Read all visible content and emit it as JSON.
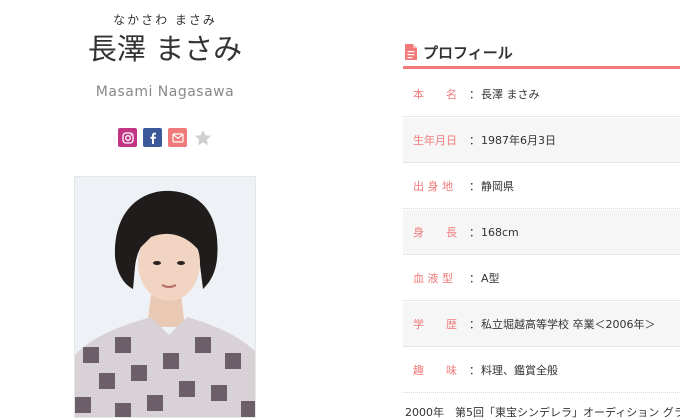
{
  "profile": {
    "furigana": "なかさわ まさみ",
    "name_jp": "長澤 まさみ",
    "name_en": "Masami Nagasawa"
  },
  "social": [
    {
      "name": "instagram-icon",
      "color": "#c13584"
    },
    {
      "name": "facebook-icon",
      "color": "#3b5998"
    },
    {
      "name": "mail-icon",
      "color": "#f07a7a"
    },
    {
      "name": "star-icon",
      "color": "#cccccc"
    }
  ],
  "section": {
    "title": "プロフィール",
    "accent": "#f07a7a"
  },
  "rows": [
    {
      "label": "本　　名",
      "value": "長澤 まさみ"
    },
    {
      "label": "生年月日",
      "value": "1987年6月3日"
    },
    {
      "label": "出 身 地",
      "value": "静岡県"
    },
    {
      "label": "身　　長",
      "value": "168cm"
    },
    {
      "label": "血 液 型",
      "value": "A型"
    },
    {
      "label": "学　　歴",
      "value": "私立堀越高等学校 卒業＜2006年＞"
    },
    {
      "label": "趣　　味",
      "value": "料理、鑑賞全般"
    }
  ],
  "career_text": "2000年　第5回「東宝シンデレラ」オーディション グラ"
}
